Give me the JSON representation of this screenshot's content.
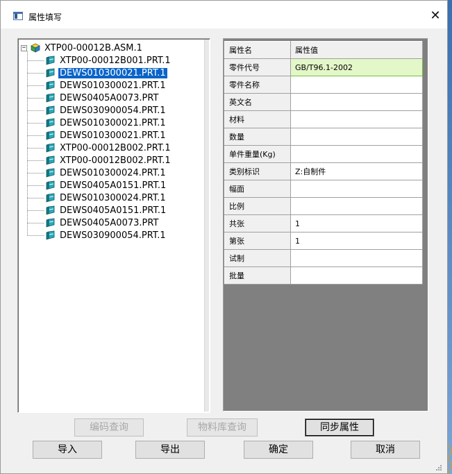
{
  "window": {
    "title": "属性填写",
    "close_glyph": "✕"
  },
  "tree": {
    "root": {
      "expander": "−",
      "label": "XTP00-00012B.ASM.1",
      "icon": "assembly-icon"
    },
    "items": [
      {
        "label": "XTP00-00012B001.PRT.1",
        "selected": false
      },
      {
        "label": "DEWS010300021.PRT.1",
        "selected": true
      },
      {
        "label": "DEWS010300021.PRT.1",
        "selected": false
      },
      {
        "label": "DEWS0405A0073.PRT",
        "selected": false
      },
      {
        "label": "DEWS030900054.PRT.1",
        "selected": false
      },
      {
        "label": "DEWS010300021.PRT.1",
        "selected": false
      },
      {
        "label": "DEWS010300021.PRT.1",
        "selected": false
      },
      {
        "label": "XTP00-00012B002.PRT.1",
        "selected": false
      },
      {
        "label": "XTP00-00012B002.PRT.1",
        "selected": false
      },
      {
        "label": "DEWS010300024.PRT.1",
        "selected": false
      },
      {
        "label": "DEWS0405A0151.PRT.1",
        "selected": false
      },
      {
        "label": "DEWS010300024.PRT.1",
        "selected": false
      },
      {
        "label": "DEWS0405A0151.PRT.1",
        "selected": false
      },
      {
        "label": "DEWS0405A0073.PRT",
        "selected": false
      },
      {
        "label": "DEWS030900054.PRT.1",
        "selected": false
      }
    ]
  },
  "grid": {
    "headers": {
      "name": "属性名",
      "value": "属性值"
    },
    "rows": [
      {
        "name": "零件代号",
        "value": "GB/T96.1-2002",
        "active": true
      },
      {
        "name": "零件名称",
        "value": ""
      },
      {
        "name": "英文名",
        "value": ""
      },
      {
        "name": "材料",
        "value": ""
      },
      {
        "name": "数量",
        "value": ""
      },
      {
        "name": "单件重量(Kg)",
        "value": ""
      },
      {
        "name": "类别标识",
        "value": "Z:自制件"
      },
      {
        "name": "幅面",
        "value": ""
      },
      {
        "name": "比例",
        "value": ""
      },
      {
        "name": "共张",
        "value": "1"
      },
      {
        "name": "第张",
        "value": "1"
      },
      {
        "name": "试制",
        "value": ""
      },
      {
        "name": "批量",
        "value": ""
      }
    ]
  },
  "buttons": {
    "code_query": "编码查询",
    "material_query": "物料库查询",
    "sync_properties": "同步属性",
    "import": "导入",
    "export": "导出",
    "ok": "确定",
    "cancel": "取消"
  },
  "colors": {
    "selection": "#0a64c8",
    "active_cell": "#e3f7c8",
    "grid_background": "#808080"
  }
}
